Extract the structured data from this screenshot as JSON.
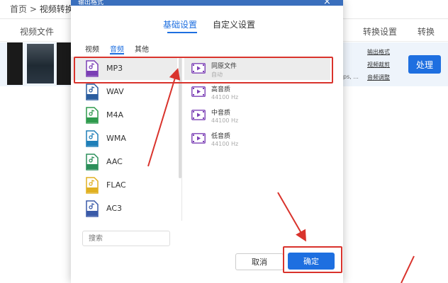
{
  "breadcrumb": {
    "home": "首页",
    "separator": ">",
    "current": "视频转换"
  },
  "table_header": {
    "video_file": "视频文件",
    "convert_settings": "转换设置",
    "convert": "转换"
  },
  "row": {
    "fragment": "ps, ...",
    "links": [
      "输出格式",
      "视频裁剪",
      "音频调整"
    ],
    "process_label": "处理"
  },
  "modal": {
    "title": "输出格式",
    "close": "×",
    "tabs": [
      "基础设置",
      "自定义设置"
    ],
    "subtabs": [
      "视频",
      "音频",
      "其他"
    ],
    "formats": [
      "MP3",
      "WAV",
      "M4A",
      "WMA",
      "AAC",
      "FLAC",
      "AC3"
    ],
    "qualities": [
      {
        "label": "同原文件",
        "sub": "自动"
      },
      {
        "label": "高音质",
        "sub": "44100 Hz"
      },
      {
        "label": "中音质",
        "sub": "44100 Hz"
      },
      {
        "label": "低音质",
        "sub": "44100 Hz"
      }
    ],
    "search_placeholder": "搜索",
    "cancel": "取消",
    "ok": "确定"
  },
  "colors": {
    "accent": "#1e6fe0",
    "annotation": "#d9332c"
  }
}
